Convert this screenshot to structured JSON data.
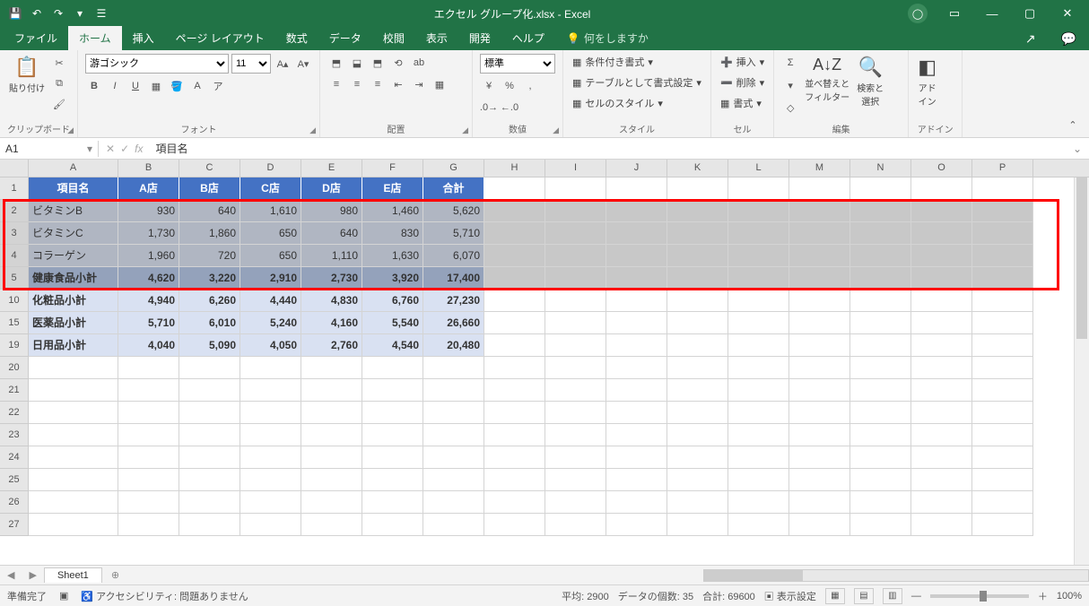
{
  "titlebar": {
    "title": "エクセル グループ化.xlsx  -  Excel"
  },
  "tabs": {
    "file": "ファイル",
    "home": "ホーム",
    "insert": "挿入",
    "layout": "ページ レイアウト",
    "formulas": "数式",
    "data": "データ",
    "review": "校閲",
    "view": "表示",
    "dev": "開発",
    "help": "ヘルプ",
    "tellme": "何をしますか"
  },
  "ribbon": {
    "clipboard": {
      "paste": "貼り付け",
      "label": "クリップボード"
    },
    "font": {
      "name": "游ゴシック",
      "size": "11",
      "label": "フォント"
    },
    "align": {
      "label": "配置"
    },
    "number": {
      "format": "標準",
      "label": "数値"
    },
    "styles": {
      "cond": "条件付き書式",
      "table": "テーブルとして書式設定",
      "cell": "セルのスタイル",
      "label": "スタイル"
    },
    "cells": {
      "insert": "挿入",
      "delete": "削除",
      "format": "書式",
      "label": "セル"
    },
    "editing": {
      "sort": "並べ替えと\nフィルター",
      "find": "検索と\n選択",
      "label": "編集"
    },
    "addin": {
      "addin": "アド\nイン",
      "label": "アドイン"
    }
  },
  "namebox": "A1",
  "formula": "項目名",
  "columns": [
    "A",
    "B",
    "C",
    "D",
    "E",
    "F",
    "G",
    "H",
    "I",
    "J",
    "K",
    "L",
    "M",
    "N",
    "O",
    "P"
  ],
  "colw": [
    "wA",
    "wB",
    "wC",
    "wD",
    "wE",
    "wF",
    "wG",
    "wH",
    "wI",
    "wJ",
    "wK",
    "wL",
    "wM",
    "wN",
    "wO",
    "wP"
  ],
  "header": [
    "項目名",
    "A店",
    "B店",
    "C店",
    "D店",
    "E店",
    "合計"
  ],
  "rows": [
    {
      "n": "1",
      "type": "hdr"
    },
    {
      "n": "2",
      "type": "sub1",
      "sel": true,
      "v": [
        "ビタミンB",
        "930",
        "640",
        "1,610",
        "980",
        "1,460",
        "5,620"
      ]
    },
    {
      "n": "3",
      "type": "sub1",
      "sel": true,
      "v": [
        "ビタミンC",
        "1,730",
        "1,860",
        "650",
        "640",
        "830",
        "5,710"
      ]
    },
    {
      "n": "4",
      "type": "sub1",
      "sel": true,
      "v": [
        "コラーゲン",
        "1,960",
        "720",
        "650",
        "1,110",
        "1,630",
        "6,070"
      ]
    },
    {
      "n": "5",
      "type": "subtotal",
      "sel": true,
      "v": [
        "健康食品小計",
        "4,620",
        "3,220",
        "2,910",
        "2,730",
        "3,920",
        "17,400"
      ]
    },
    {
      "n": "10",
      "type": "sub2",
      "v": [
        "化粧品小計",
        "4,940",
        "6,260",
        "4,440",
        "4,830",
        "6,760",
        "27,230"
      ]
    },
    {
      "n": "15",
      "type": "sub2",
      "v": [
        "医薬品小計",
        "5,710",
        "6,010",
        "5,240",
        "4,160",
        "5,540",
        "26,660"
      ]
    },
    {
      "n": "19",
      "type": "sub2",
      "v": [
        "日用品小計",
        "4,040",
        "5,090",
        "4,050",
        "2,760",
        "4,540",
        "20,480"
      ]
    },
    {
      "n": "20",
      "type": "blank"
    },
    {
      "n": "21",
      "type": "blank"
    },
    {
      "n": "22",
      "type": "blank"
    },
    {
      "n": "23",
      "type": "blank"
    },
    {
      "n": "24",
      "type": "blank"
    },
    {
      "n": "25",
      "type": "blank"
    },
    {
      "n": "26",
      "type": "blank"
    },
    {
      "n": "27",
      "type": "blank"
    }
  ],
  "sheet": {
    "name": "Sheet1"
  },
  "status": {
    "ready": "準備完了",
    "a11y": "アクセシビリティ: 問題ありません",
    "avg": "平均: 2900",
    "count": "データの個数: 35",
    "sum": "合計: 69600",
    "disp": "表示設定",
    "zoom": "100%"
  }
}
